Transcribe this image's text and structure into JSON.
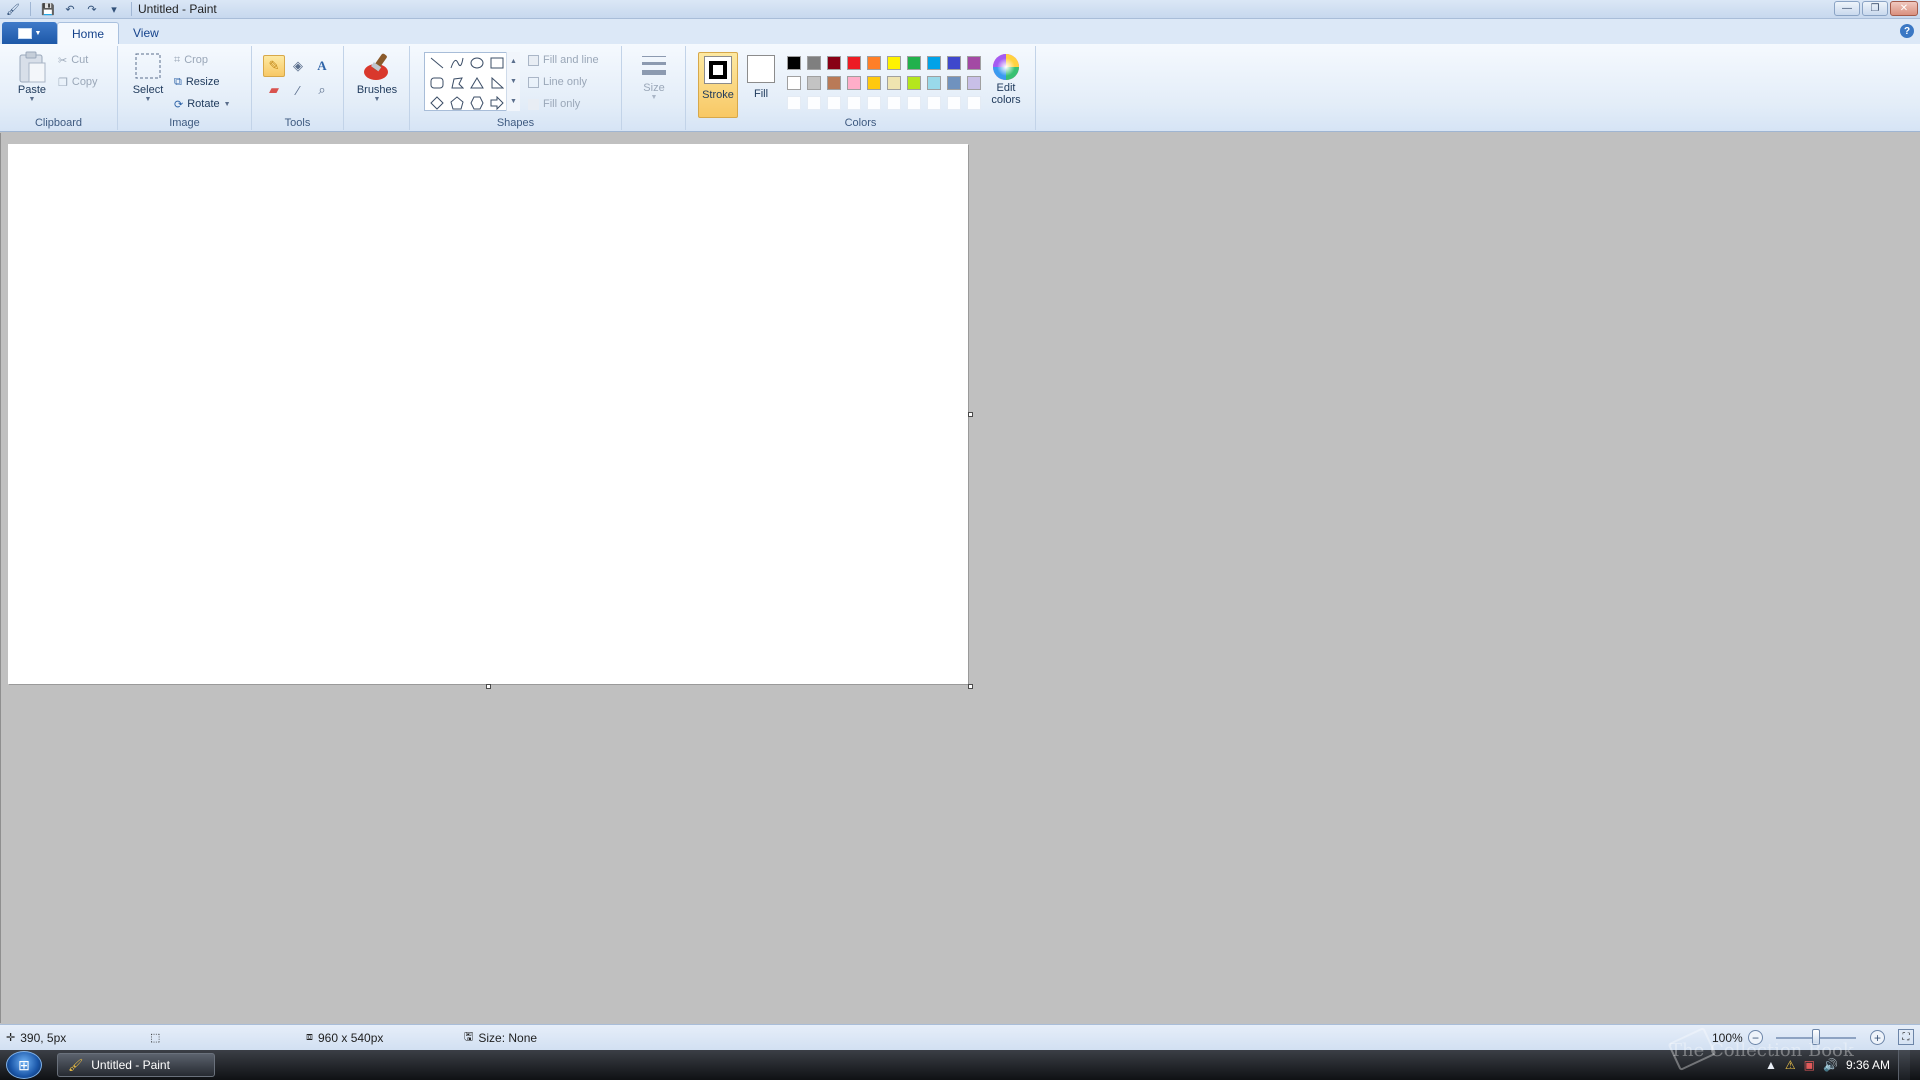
{
  "window": {
    "title": "Untitled - Paint",
    "controls": {
      "minimize": "—",
      "maximize": "❐",
      "close": "✕"
    }
  },
  "quick_access": {
    "save": "💾",
    "undo": "↶",
    "redo": "↷",
    "customize": "▾"
  },
  "tabs": [
    {
      "label": "Home",
      "active": true
    },
    {
      "label": "View",
      "active": false
    }
  ],
  "help": "?",
  "ribbon": {
    "clipboard": {
      "label": "Clipboard",
      "paste": "Paste",
      "cut": "Cut",
      "copy": "Copy"
    },
    "image": {
      "label": "Image",
      "select": "Select",
      "crop": "Crop",
      "resize": "Resize",
      "rotate": "Rotate"
    },
    "tools": {
      "label": "Tools"
    },
    "brushes": {
      "label": "Brushes"
    },
    "shapes": {
      "label": "Shapes",
      "fill_and_line": "Fill and line",
      "line_only": "Line only",
      "fill_only": "Fill only"
    },
    "size": {
      "label": "Size"
    },
    "colors": {
      "label": "Colors",
      "stroke": "Stroke",
      "fill": "Fill",
      "edit_colors_line1": "Edit",
      "edit_colors_line2": "colors",
      "palette_row1": [
        "#000000",
        "#7f7f7f",
        "#880015",
        "#ed1c24",
        "#ff7f27",
        "#fff200",
        "#22b14c",
        "#00a2e8",
        "#3f48cc",
        "#a349a4"
      ],
      "palette_row2": [
        "#ffffff",
        "#c3c3c3",
        "#b97a57",
        "#ffaec9",
        "#ffc90e",
        "#efe4b0",
        "#b5e61d",
        "#99d9ea",
        "#7092be",
        "#c8bfe7"
      ]
    }
  },
  "statusbar": {
    "cursor_pos": "390, 5px",
    "image_size": "960 x 540px",
    "file_size": "Size: None",
    "zoom": "100%"
  },
  "taskbar": {
    "task_label": "Untitled - Paint",
    "clock": "9:36 AM"
  },
  "watermark": "The Collection Book"
}
